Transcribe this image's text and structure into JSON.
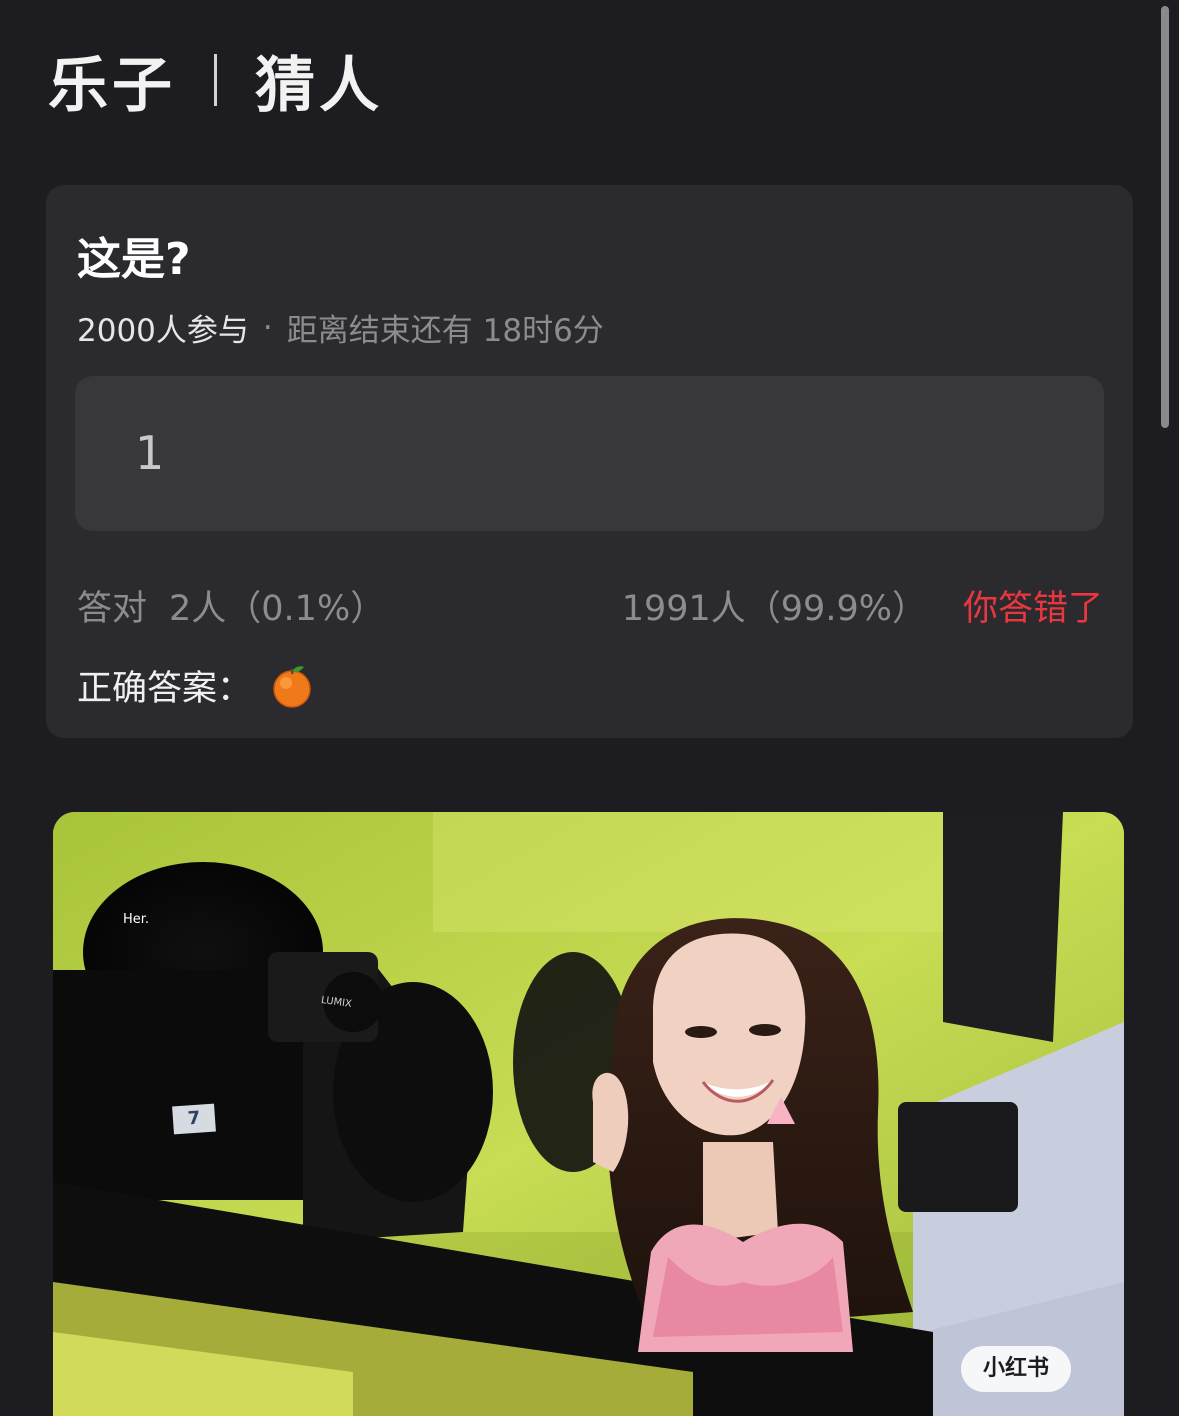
{
  "header": {
    "category": "乐子",
    "subcategory": "猜人"
  },
  "quiz": {
    "question": "这是?",
    "participants": "2000人参与",
    "separator": "·",
    "countdown": "距离结束还有 18时6分",
    "user_answer": "1",
    "correct_label": "答对",
    "correct_stats": "2人（0.1%）",
    "wrong_stats": "1991人（99.9%）",
    "result_text": "你答错了",
    "correct_answer_label": "正确答案：",
    "correct_answer_icon": "orange-fruit-icon"
  },
  "photo": {
    "sign_text": "Her.",
    "camera_brand": "LUMIX",
    "number_tag": "7",
    "watermark": "小红书"
  },
  "colors": {
    "background": "#1d1d21",
    "card": "#2a2a2f",
    "answer_box": "#37373c",
    "muted_text": "#8c8c90",
    "error_red": "#e8373f"
  }
}
